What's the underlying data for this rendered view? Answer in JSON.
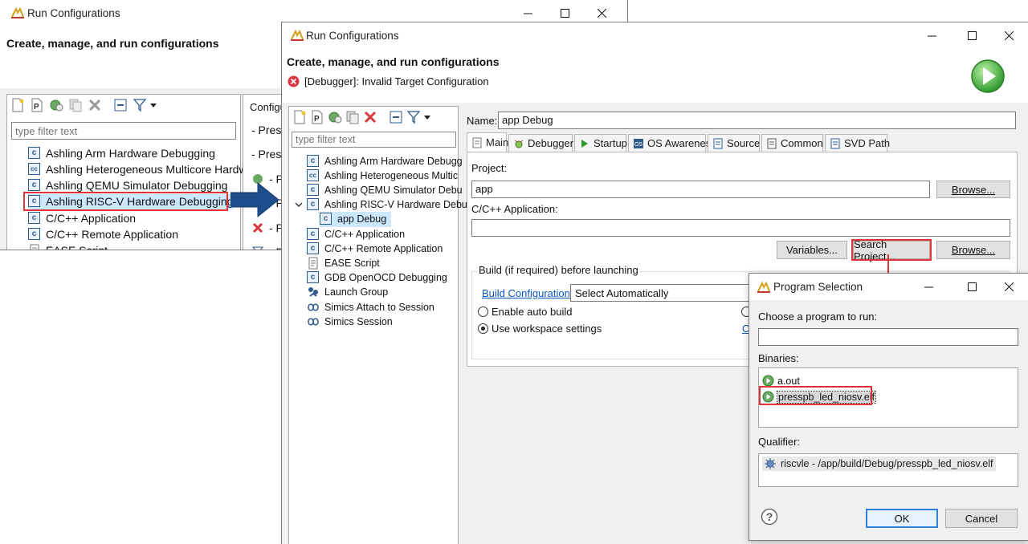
{
  "colors": {
    "accent_red": "#e0333a",
    "arrow_blue": "#1f4e8c",
    "link_blue": "#0b57c4",
    "selection": "#cce8ff"
  },
  "bg_window": {
    "title": "Run Configurations",
    "header_title": "Create, manage, and run configurations",
    "filter_placeholder": "type filter text",
    "tree": [
      {
        "label": "Ashling Arm Hardware Debugging",
        "icon": "c-config-icon"
      },
      {
        "label": "Ashling Heterogeneous Multicore Hardw",
        "icon": "multicore-config-icon"
      },
      {
        "label": "Ashling QEMU Simulator Debugging",
        "icon": "c-config-icon"
      },
      {
        "label": "Ashling RISC-V Hardware Debugging",
        "icon": "c-config-icon"
      },
      {
        "label": "C/C++ Application",
        "icon": "c-config-icon"
      },
      {
        "label": "C/C++ Remote Application",
        "icon": "c-config-icon"
      },
      {
        "label": "EASE Script",
        "icon": "script-icon"
      }
    ],
    "right_header": "Configu",
    "right_items": [
      "- Press",
      "- Press",
      "- P",
      "- P",
      "- P",
      "- P"
    ]
  },
  "main_window": {
    "title": "Run Configurations",
    "header_title": "Create, manage, and run configurations",
    "error_message": "[Debugger]: Invalid Target Configuration",
    "filter_placeholder": "type filter text",
    "tree": [
      {
        "label": "Ashling Arm Hardware Debugg",
        "icon": "c-config-icon"
      },
      {
        "label": "Ashling Heterogeneous Multic",
        "icon": "multicore-config-icon"
      },
      {
        "label": "Ashling QEMU Simulator Debu",
        "icon": "c-config-icon"
      },
      {
        "label": "Ashling RISC-V Hardware Debu",
        "icon": "c-config-icon"
      },
      {
        "label": "app Debug",
        "icon": "c-config-icon"
      },
      {
        "label": "C/C++ Application",
        "icon": "c-config-icon"
      },
      {
        "label": "C/C++ Remote Application",
        "icon": "c-config-icon"
      },
      {
        "label": "EASE Script",
        "icon": "script-icon"
      },
      {
        "label": "GDB OpenOCD Debugging",
        "icon": "c-config-icon"
      },
      {
        "label": "Launch Group",
        "icon": "launch-group-icon"
      },
      {
        "label": "Simics Attach to Session",
        "icon": "simics-icon"
      },
      {
        "label": "Simics Session",
        "icon": "simics-icon"
      }
    ],
    "name_label": "Name:",
    "name_value": "app Debug",
    "tabs": [
      "Main",
      "Debugger",
      "Startup",
      "OS Awareness",
      "Source",
      "Common",
      "SVD Path"
    ],
    "project_label": "Project:",
    "project_value": "app",
    "browse_label": "Browse...",
    "cpp_app_label": "C/C++ Application:",
    "cpp_app_value": "",
    "variables_label": "Variables...",
    "search_project_label": "Search Project...",
    "build_group_label": "Build (if required) before launching",
    "build_config_link": "Build Configuration:",
    "build_config_value": "Select Automatically",
    "enable_auto_build": "Enable auto build",
    "use_workspace_settings": "Use workspace settings",
    "c_link_fragment": "C"
  },
  "program_dialog": {
    "title": "Program Selection",
    "choose_label": "Choose a program to run:",
    "choose_value": "",
    "binaries_label": "Binaries:",
    "binaries": [
      "a.out",
      "presspb_led_niosv.elf"
    ],
    "qualifier_label": "Qualifier:",
    "qualifier_value": "riscvle - /app/build/Debug/presspb_led_niosv.elf",
    "ok_label": "OK",
    "cancel_label": "Cancel"
  }
}
